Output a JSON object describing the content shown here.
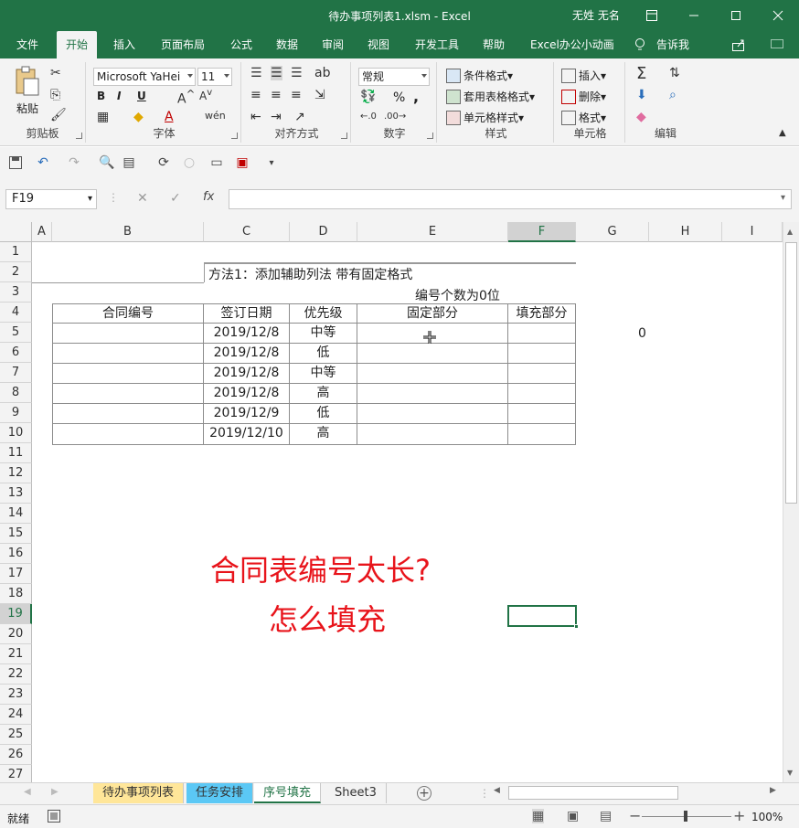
{
  "window": {
    "title": "待办事项列表1.xlsm  -  Excel",
    "user": "无姓 无名",
    "accent": "#217346"
  },
  "tabs": [
    "文件",
    "开始",
    "插入",
    "页面布局",
    "公式",
    "数据",
    "审阅",
    "视图",
    "开发工具",
    "帮助",
    "Excel办公小动画",
    "告诉我"
  ],
  "ribbon": {
    "clipboard": {
      "paste": "粘贴",
      "label": "剪贴板"
    },
    "font": {
      "name": "Microsoft YaHei",
      "size": "11",
      "bold": "B",
      "italic": "I",
      "underline": "U",
      "label": "字体"
    },
    "alignment": {
      "label": "对齐方式"
    },
    "number": {
      "format": "常规",
      "percent": "%",
      "comma": ",",
      "label": "数字"
    },
    "styles": {
      "conditional": "条件格式",
      "table": "套用表格格式",
      "cell": "单元格样式",
      "label": "样式"
    },
    "cells": {
      "insert": "插入",
      "delete": "删除",
      "format": "格式",
      "label": "单元格"
    },
    "editing": {
      "label": "编辑"
    }
  },
  "formula_bar": {
    "name_box": "F19",
    "fx": "fx",
    "content": ""
  },
  "columns": [
    "A",
    "B",
    "C",
    "D",
    "E",
    "F",
    "G",
    "H",
    "I"
  ],
  "rows": [
    "1",
    "2",
    "3",
    "4",
    "5",
    "6",
    "7",
    "8",
    "9",
    "10",
    "11",
    "12",
    "13",
    "14",
    "15",
    "16",
    "17",
    "18",
    "19",
    "20",
    "21",
    "22",
    "23",
    "24",
    "25",
    "26",
    "27"
  ],
  "sheet": {
    "c2": "方法1：添加辅助列法       带有固定格式",
    "e3": "编号个数为0位",
    "headers": [
      "合同编号",
      "签订日期",
      "优先级",
      "固定部分",
      "填充部分"
    ],
    "data_rows": [
      {
        "date": "2019/12/8",
        "priority": "中等"
      },
      {
        "date": "2019/12/8",
        "priority": "低"
      },
      {
        "date": "2019/12/8",
        "priority": "中等"
      },
      {
        "date": "2019/12/8",
        "priority": "高"
      },
      {
        "date": "2019/12/9",
        "priority": "低"
      },
      {
        "date": "2019/12/10",
        "priority": "高"
      }
    ],
    "g5": "0",
    "overlay_line1": "合同表编号太长?",
    "overlay_line2": "怎么填充",
    "overlay_color": "#e8141b"
  },
  "sheet_tabs": [
    "待办事项列表",
    "任务安排",
    "序号填充",
    "Sheet3"
  ],
  "sheet_tab_colors": [
    "#ffe699",
    "#5bc8f5",
    "",
    ""
  ],
  "status": {
    "mode": "就绪",
    "zoom": "100%"
  }
}
